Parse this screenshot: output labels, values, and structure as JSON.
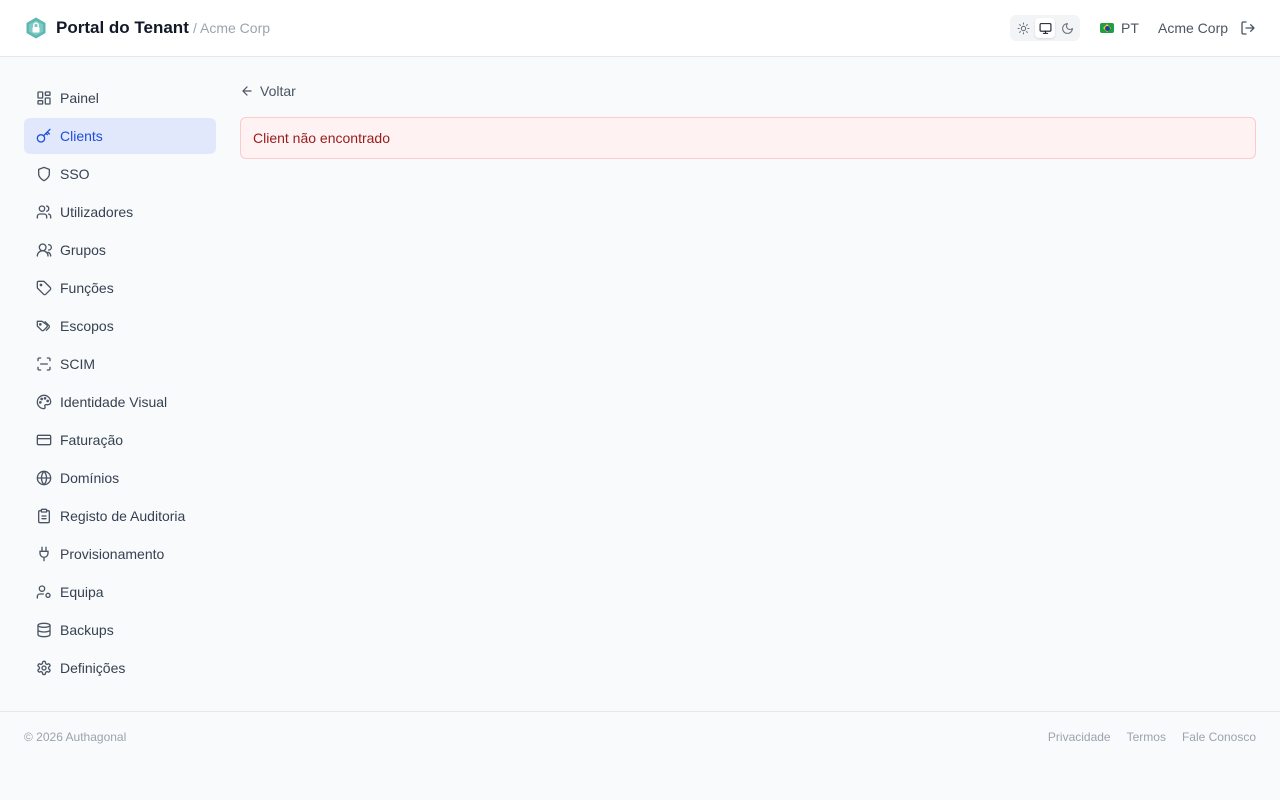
{
  "header": {
    "app_title": "Portal do Tenant",
    "tenant_crumb": "/ Acme Corp",
    "theme_modes": [
      "sun-icon",
      "monitor-icon",
      "moon-icon"
    ],
    "active_theme": "monitor-icon",
    "language": {
      "flag": "brazil-flag-icon",
      "label": "PT"
    },
    "tenant_name": "Acme Corp",
    "logout_icon": "logout-icon"
  },
  "sidebar": {
    "items": [
      {
        "label": "Painel",
        "icon": "dashboard-icon",
        "active": false
      },
      {
        "label": "Clients",
        "icon": "key-icon",
        "active": true
      },
      {
        "label": "SSO",
        "icon": "shield-icon",
        "active": false
      },
      {
        "label": "Utilizadores",
        "icon": "users-icon",
        "active": false
      },
      {
        "label": "Grupos",
        "icon": "group-icon",
        "active": false
      },
      {
        "label": "Funções",
        "icon": "tag-icon",
        "active": false
      },
      {
        "label": "Escopos",
        "icon": "tags-icon",
        "active": false
      },
      {
        "label": "SCIM",
        "icon": "scan-icon",
        "active": false
      },
      {
        "label": "Identidade Visual",
        "icon": "palette-icon",
        "active": false
      },
      {
        "label": "Faturação",
        "icon": "credit-card-icon",
        "active": false
      },
      {
        "label": "Domínios",
        "icon": "globe-icon",
        "active": false
      },
      {
        "label": "Registo de Auditoria",
        "icon": "clipboard-icon",
        "active": false
      },
      {
        "label": "Provisionamento",
        "icon": "plug-icon",
        "active": false
      },
      {
        "label": "Equipa",
        "icon": "user-cog-icon",
        "active": false
      },
      {
        "label": "Backups",
        "icon": "database-icon",
        "active": false
      },
      {
        "label": "Definições",
        "icon": "gear-icon",
        "active": false
      }
    ]
  },
  "main": {
    "back_label": "Voltar",
    "error_message": "Client não encontrado"
  },
  "footer": {
    "copyright": "© 2026 Authagonal",
    "links": [
      "Privacidade",
      "Termos",
      "Fale Conosco"
    ]
  },
  "colors": {
    "brand": "#5eb8b0",
    "active_nav_bg": "#e2e8fc",
    "active_nav_text": "#1d4ed8",
    "error_bg": "#fef2f2",
    "error_border": "#fecaca",
    "error_text": "#991b1b"
  }
}
